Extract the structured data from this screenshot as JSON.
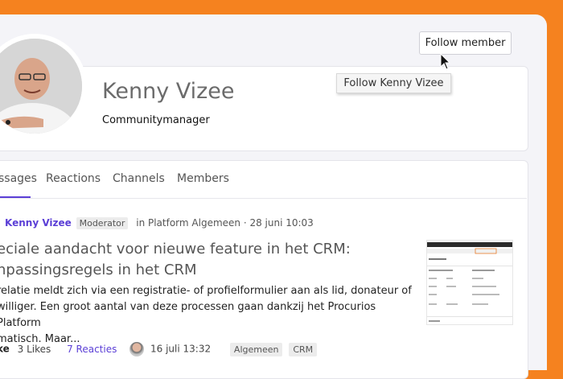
{
  "profile": {
    "name": "Kenny Vizee",
    "role": "Communitymanager",
    "follow_label": "Follow member",
    "tooltip": "Follow Kenny Vizee"
  },
  "tabs": [
    {
      "label": "ssages"
    },
    {
      "label": "Reactions"
    },
    {
      "label": "Channels"
    },
    {
      "label": "Members"
    }
  ],
  "post": {
    "author": "Kenny Vizee",
    "badge": "Moderator",
    "meta": "in Platform Algemeen · 28 juni 10:03",
    "title_line1": "eciale aandacht voor nieuwe feature in het CRM:",
    "title_line2": "npassingsregels in het CRM",
    "excerpt_line1": "relatie meldt zich via een registratie- of profielformulier aan als lid, donateur of",
    "excerpt_line2": "williger. Een groot aantal van deze processen gaan dankzij het Procurios Platform",
    "excerpt_line3": "matisch. Maar...",
    "like_label": "ke",
    "likes": "3 Likes",
    "reactions": "7 Reacties",
    "last_date": "16 juli 13:32",
    "tags": [
      "Algemeen",
      "CRM"
    ]
  },
  "colors": {
    "accent": "#5b3fd6",
    "brand_orange": "#f5821f"
  },
  "icons": {
    "cursor": "arrow-cursor-icon"
  }
}
